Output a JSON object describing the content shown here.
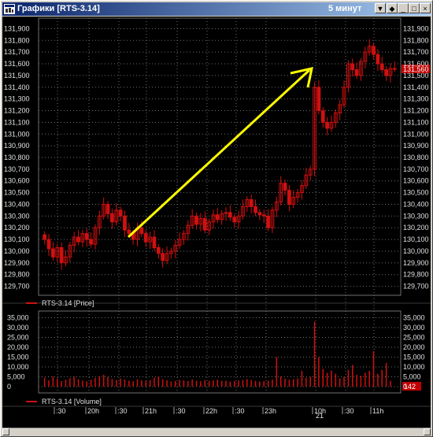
{
  "window": {
    "title": "Графики [RTS-3.14]",
    "interval": "5 минут",
    "interval_arrow": "▼",
    "pin_glyph": "◆",
    "minimize_glyph": "_",
    "maximize_glyph": "□",
    "close_glyph": "×"
  },
  "colors": {
    "background": "#000000",
    "grid": "#6e6e6e",
    "candle": "#d01010",
    "text": "#e0e0e0",
    "arrow": "#ffff00",
    "price_marker": "#c00000"
  },
  "price_panel": {
    "legend": "RTS-3.14 [Price]",
    "y_labels": [
      "131,900",
      "131,800",
      "131,700",
      "131,600",
      "131,500",
      "131,400",
      "131,300",
      "131,200",
      "131,100",
      "131,000",
      "130,900",
      "130,800",
      "130,700",
      "130,600",
      "130,500",
      "130,400",
      "130,300",
      "130,200",
      "130,100",
      "130,000",
      "129,900",
      "129,800",
      "129,700"
    ],
    "current_price": "131,560"
  },
  "volume_panel": {
    "legend": "RTS-3.14 [Volume]",
    "y_labels": [
      "35,000",
      "30,000",
      "25,000",
      "20,000",
      "15,000",
      "10,000",
      "5,000",
      "0"
    ],
    "current_volume": "142"
  },
  "time_axis": {
    "labels": [
      ":30",
      "20h",
      ":30",
      "21h",
      ":30",
      "22h",
      ":30",
      "23h",
      "10h",
      ":30",
      "11h"
    ],
    "date_label": "21"
  },
  "chart_data": {
    "type": "candlestick",
    "series_name": "RTS-3.14",
    "x_labels": [
      ":30",
      "20h",
      ":30",
      "21h",
      ":30",
      "22h",
      ":30",
      "23h",
      "10h",
      ":30",
      "11h"
    ],
    "ylim": [
      129650,
      131950
    ],
    "close": [
      130100,
      130020,
      129950,
      130030,
      129900,
      129950,
      130050,
      130120,
      130080,
      130150,
      130100,
      130060,
      130200,
      130300,
      130400,
      130320,
      130250,
      130350,
      130300,
      130180,
      130150,
      130100,
      130200,
      130150,
      130080,
      130120,
      130030,
      129980,
      129920,
      129980,
      130000,
      130050,
      130100,
      130150,
      130220,
      130300,
      130230,
      130280,
      130180,
      130250,
      130310,
      130270,
      130320,
      130330,
      130290,
      130250,
      130300,
      130380,
      130440,
      130380,
      130330,
      130310,
      130300,
      130200,
      130350,
      130420,
      130580,
      130520,
      130400,
      130460,
      130500,
      130560,
      130650,
      130700,
      131400,
      131200,
      131100,
      131050,
      131100,
      131180,
      131250,
      131400,
      131600,
      131550,
      131500,
      131620,
      131700,
      131750,
      131680,
      131600,
      131550,
      131500,
      131560,
      131560
    ],
    "volume": [
      4500,
      3200,
      5100,
      4000,
      2800,
      3500,
      4200,
      5000,
      3800,
      3100,
      2600,
      3400,
      4400,
      5200,
      6000,
      4800,
      3900,
      3300,
      4100,
      3600,
      3000,
      2700,
      3800,
      3200,
      2900,
      3300,
      4600,
      5200,
      3800,
      3200,
      2500,
      2900,
      3400,
      3100,
      2800,
      3600,
      3000,
      2700,
      3300,
      2900,
      3200,
      3500,
      2900,
      3000,
      2500,
      2800,
      3100,
      3400,
      3800,
      3300,
      2900,
      2600,
      2800,
      3000,
      3600,
      15000,
      5200,
      4100,
      3500,
      3800,
      4200,
      8000,
      4500,
      5000,
      33000,
      15000,
      9000,
      7000,
      8200,
      6500,
      4200,
      5000,
      8500,
      11000,
      6000,
      5500,
      7000,
      8000,
      18000,
      6500,
      8500,
      12000,
      3000,
      142
    ]
  }
}
